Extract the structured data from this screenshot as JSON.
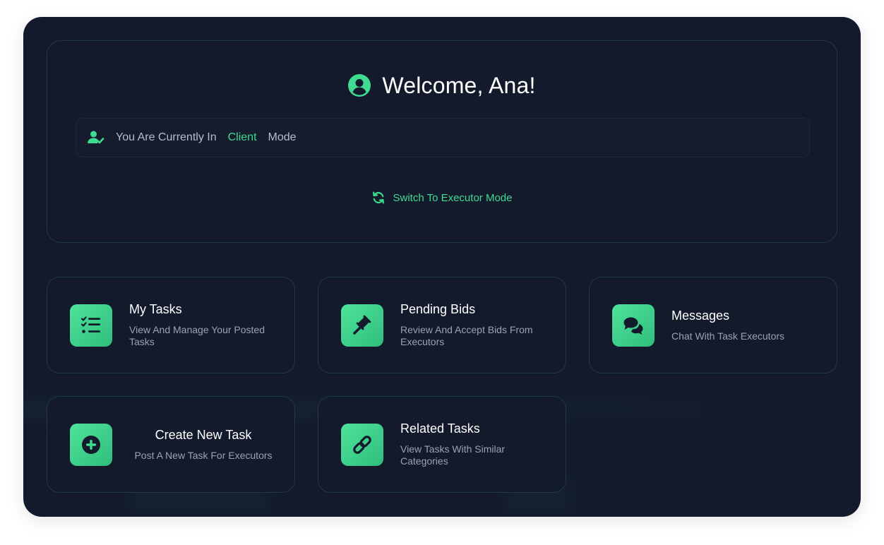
{
  "header": {
    "welcome_title": "Welcome, Ana!",
    "avatar_icon": "user-circle-icon"
  },
  "mode_bar": {
    "prefix": "You Are Currently In",
    "mode": "Client",
    "suffix": "Mode",
    "icon": "user-check-icon"
  },
  "switch_mode": {
    "label": "Switch To Executor Mode",
    "icon": "sync-icon"
  },
  "tiles": [
    {
      "title": "My Tasks",
      "description": "View And Manage Your Posted Tasks",
      "icon": "task-list-icon"
    },
    {
      "title": "Pending Bids",
      "description": "Review And Accept Bids From Executors",
      "icon": "gavel-icon"
    },
    {
      "title": "Messages",
      "description": "Chat With Task Executors",
      "icon": "chat-bubbles-icon"
    },
    {
      "title": "Create New Task",
      "description": "Post A New Task For Executors",
      "icon": "plus-circle-icon"
    },
    {
      "title": "Related Tasks",
      "description": "View Tasks With Similar Categories",
      "icon": "link-icon"
    }
  ],
  "colors": {
    "accent": "#3ddc91",
    "background": "#131a2c",
    "border": "#1f3a44",
    "text_muted": "#9aa3b2"
  }
}
